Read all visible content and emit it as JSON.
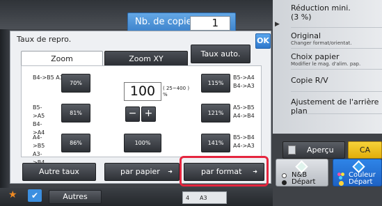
{
  "copies": {
    "label": "Nb. de copies",
    "value": "1"
  },
  "right_panel": {
    "items": [
      {
        "label": "Réduction mini.",
        "sub": "(3 %)"
      },
      {
        "label": "Original",
        "sub": "Changer format/orientat."
      },
      {
        "label": "Choix papier",
        "sub": "Modifier le mag. d'alim. pap."
      },
      {
        "label": "Copie R/V",
        "sub": ""
      },
      {
        "label": "Ajustement de l'arrière plan",
        "sub": ""
      }
    ]
  },
  "dialog": {
    "title": "Taux de repro.",
    "ok_label": "OK",
    "tabs": [
      "Zoom",
      "Zoom XY"
    ],
    "auto_label": "Taux auto.",
    "value": "100",
    "range": "( 25~400 ) %",
    "minus": "−",
    "plus": "+",
    "presets": [
      {
        "side": "left",
        "label": "B4->B5 A3->A4",
        "value": "70%"
      },
      {
        "side": "left",
        "label": "B5->A5 B4->A4",
        "value": "81%"
      },
      {
        "side": "left",
        "label": "A4->B5 A3->B4",
        "value": "86%"
      },
      {
        "side": "center",
        "label": "",
        "value": "100%"
      },
      {
        "side": "right",
        "label": "B5->A4 B4->A3",
        "value": "115%"
      },
      {
        "side": "right",
        "label": "A5->B5 A4->B4",
        "value": "121%"
      },
      {
        "side": "right",
        "label": "B5->B4 A4->A3",
        "value": "141%"
      }
    ],
    "bottom_buttons": [
      {
        "label": "Autre taux",
        "arrow": ""
      },
      {
        "label": "par papier",
        "arrow": "➜"
      },
      {
        "label": "par format",
        "arrow": "➜"
      }
    ]
  },
  "actions": {
    "preview": "Aperçu",
    "ca": "CA",
    "bw": {
      "line1": "N&B",
      "line2": "Départ"
    },
    "color": {
      "line1": "Couleur",
      "line2": "Départ"
    }
  },
  "bottom_bar": {
    "autres": "Autres",
    "status_count": "4",
    "status_size": "A3"
  },
  "colors": {
    "accent_blue": "#3d82cb",
    "highlight_red": "#e5253e",
    "ca_yellow": "#e2ae0a",
    "star_orange": "#f08a22"
  }
}
